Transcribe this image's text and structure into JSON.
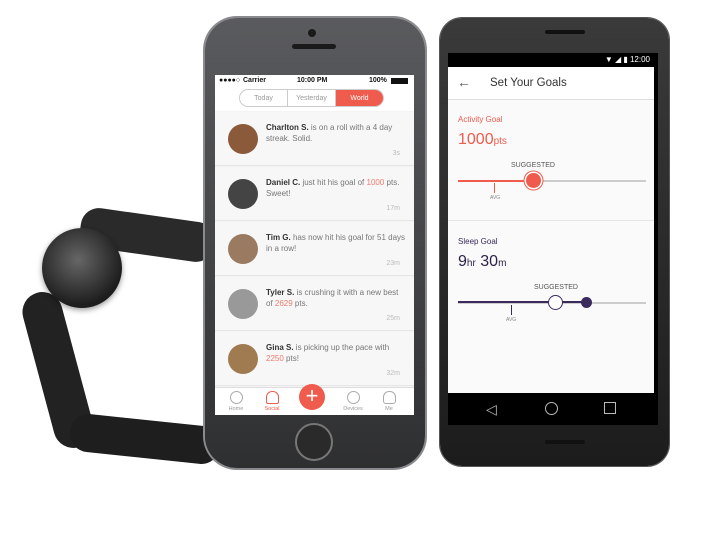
{
  "iphone": {
    "status": {
      "carrier": "Carrier",
      "time": "10:00 PM",
      "battery": "100%"
    },
    "segments": [
      {
        "label": "Today",
        "active": false
      },
      {
        "label": "Yesterday",
        "active": false
      },
      {
        "label": "World",
        "active": true
      }
    ],
    "feed": [
      {
        "name": "Charlton S.",
        "pre": " is on a roll with a 4 day streak. Solid.",
        "hl": "",
        "post": "",
        "time": "3s",
        "avatar_color": "#8a5a3a"
      },
      {
        "name": "Daniel C.",
        "pre": " just hit his goal of ",
        "hl": "1000",
        "post": " pts. Sweet!",
        "time": "17m",
        "avatar_color": "#444"
      },
      {
        "name": "Tim G.",
        "pre": " has now hit his goal for 51 days in a row!",
        "hl": "",
        "post": "",
        "time": "23m",
        "avatar_color": "#9a7a60"
      },
      {
        "name": "Tyler S.",
        "pre": " is crushing it with a new best of ",
        "hl": "2629",
        "post": " pts.",
        "time": "25m",
        "avatar_color": "#999"
      },
      {
        "name": "Gina S.",
        "pre": " is picking up the pace with ",
        "hl": "2250",
        "post": " pts!",
        "time": "32m",
        "avatar_color": "#a07a50"
      }
    ],
    "tabs": [
      {
        "label": "Home",
        "icon": "circle-icon"
      },
      {
        "label": "Social",
        "icon": "people-icon",
        "active": true
      },
      {
        "label": "",
        "icon": "plus-icon"
      },
      {
        "label": "Devices",
        "icon": "circle-icon"
      },
      {
        "label": "Me",
        "icon": "person-icon"
      }
    ]
  },
  "android": {
    "status": {
      "time": "12:00"
    },
    "title": "Set Your Goals",
    "activity": {
      "label": "Activity Goal",
      "value": "1000",
      "unit": "pts",
      "suggested": "SUGGESTED",
      "avg": "AVG",
      "level": 0.4
    },
    "sleep": {
      "label": "Sleep Goal",
      "hours": "9",
      "hr_unit": "hr",
      "minutes": "30",
      "min_unit": "m",
      "suggested": "SUGGESTED",
      "avg": "AVG",
      "level": 0.68
    }
  },
  "colors": {
    "accent": "#ef5b4c",
    "sleep": "#3b2a5c"
  }
}
